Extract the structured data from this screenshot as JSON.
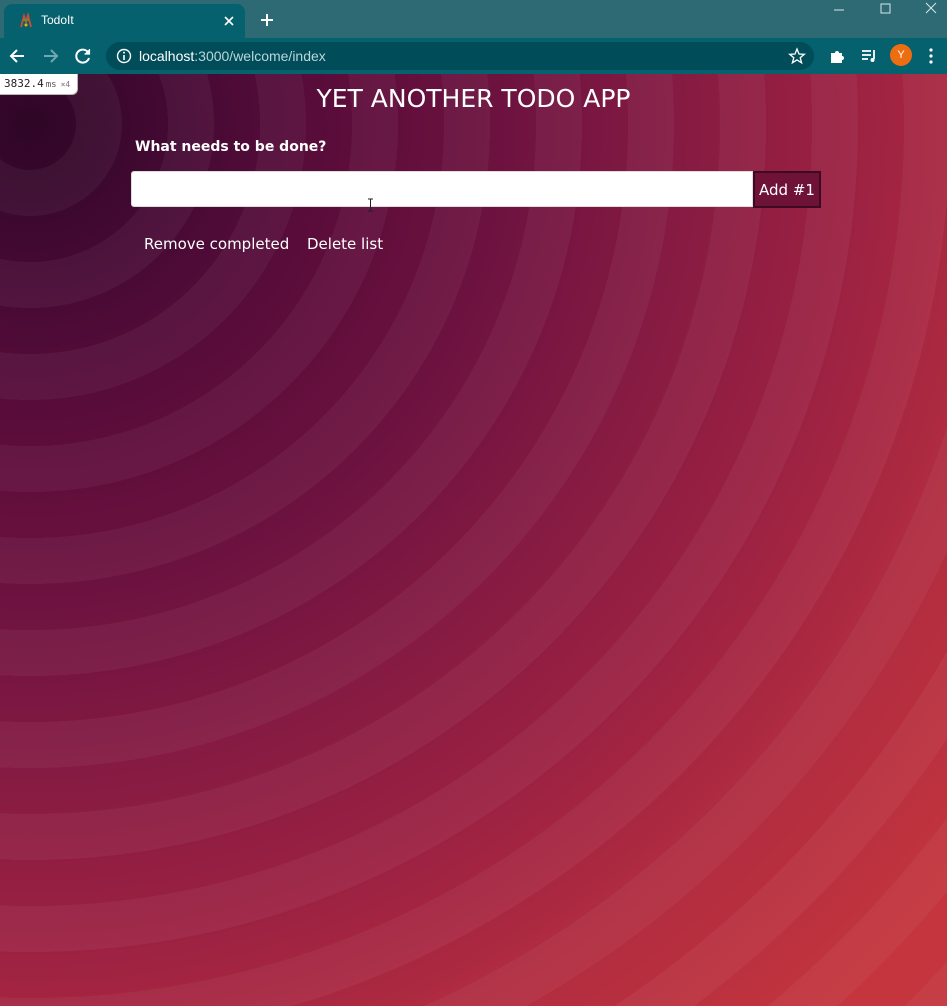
{
  "browser": {
    "tab_title": "TodoIt",
    "url_host": "localhost",
    "url_path": ":3000/welcome/index",
    "avatar_letter": "Y",
    "accent_color": "#06616f",
    "avatar_color": "#ec6e11"
  },
  "perf_overlay": {
    "value": "3832.4",
    "unit": "ms",
    "multiplier": "×4"
  },
  "page": {
    "title": "YET ANOTHER TODO APP",
    "prompt": "What needs to be done?",
    "input_value": "",
    "add_button": "Add #1",
    "remove_completed": "Remove completed",
    "delete_list": "Delete list",
    "background_gradient": [
      "#2e0626",
      "#6f1340",
      "#c4353d"
    ]
  }
}
